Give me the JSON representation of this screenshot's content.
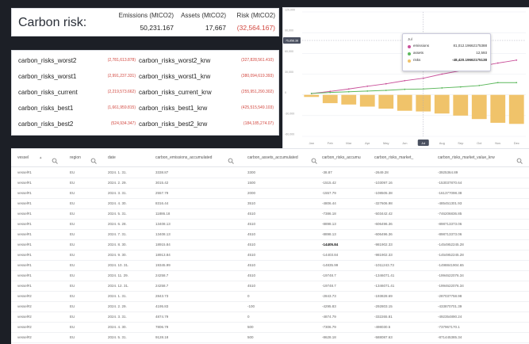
{
  "summary": {
    "title": "Carbon risk:",
    "emissions_header": "Emissions (MtCO2)",
    "emissions_value": "50,231.167",
    "assets_header": "Assets (MtCO2)",
    "assets_value": "17,667",
    "risk_header": "Risk (MtCO2)",
    "risk_value": "(32,564.167)"
  },
  "risk_list": [
    {
      "name": "carbon_risks_worst2",
      "value": "(2,781,613.878)",
      "krw_name": "carbon_risks_worst2_krw",
      "krw_value": "(327,828,561.410)"
    },
    {
      "name": "carbon_risks_worst1",
      "value": "(2,991,237.331)",
      "krw_name": "carbon_risks_worst1_krw",
      "krw_value": "(380,094,619.393)"
    },
    {
      "name": "carbon_risks_current",
      "value": "(2,219,573.662)",
      "krw_name": "carbon_risks_current_krw",
      "krw_value": "(255,951,290.302)"
    },
    {
      "name": "carbon_risks_best1",
      "value": "(1,661,959.815)",
      "krw_name": "carbon_risks_best1_krw",
      "krw_value": "(425,515,549.103)"
    },
    {
      "name": "carbon_risks_best2",
      "value": "(524,934.347)",
      "krw_name": "carbon_risks_best2_krw",
      "krw_value": "(184,185,274.07)"
    }
  ],
  "chart_data": {
    "type": "bar",
    "categories": [
      "Jan",
      "Feb",
      "Mar",
      "Apr",
      "May",
      "Jun",
      "Jul",
      "Aug",
      "Sep",
      "Oct",
      "Nov",
      "Dec"
    ],
    "series": [
      {
        "name": "emissions",
        "type": "line",
        "color": "#c9509a",
        "values": [
          2000,
          5000,
          8500,
          12500,
          16000,
          20500,
          24000,
          30000,
          35000,
          41000,
          46000,
          50231
        ]
      },
      {
        "name": "assets",
        "type": "line",
        "color": "#5cb85c",
        "values": [
          2000,
          3500,
          4500,
          5500,
          6500,
          8000,
          8500,
          10000,
          11500,
          13500,
          17667,
          17667
        ]
      },
      {
        "name": "risks",
        "type": "bar",
        "color": "#f0c36a",
        "values": [
          -3000,
          -12000,
          -14000,
          -17000,
          -20000,
          -23000,
          -24000,
          -27000,
          -30000,
          -35000,
          -40429,
          -42000
        ]
      }
    ],
    "ylim": [
      -60000,
      120000
    ],
    "yticks": [
      "120,000",
      "90,000",
      "60,000",
      "30,000",
      "0",
      "-30,000",
      "-60,000"
    ],
    "crosshair_label": "75,858.38",
    "active_category": "Jul",
    "tooltip": {
      "title": "Jul",
      "rows": [
        {
          "name": "emissions",
          "value": "81,012.19662175388"
        },
        {
          "name": "assets",
          "value": "12,593"
        },
        {
          "name": "risks",
          "value": "-48,420.19662175138"
        }
      ]
    }
  },
  "table": {
    "columns": [
      "vessel",
      "region",
      "date",
      "carbon_emissions_accumulated",
      "carbon_assets_accumulated",
      "carbon_risks_accumu",
      "carbon_risks_market_",
      "carbon_risks_market_value_krw"
    ],
    "rows": [
      [
        "vessel#1",
        "EU",
        "2024. 1. 31.",
        "3338.87",
        "3300",
        "-38.87",
        "-2649.28",
        "-3925364.89"
      ],
      [
        "vessel#1",
        "EU",
        "2024. 2. 29.",
        "3015.42",
        "1500",
        "-1515.42",
        "-103097.16",
        "-153037870.64"
      ],
      [
        "vessel#1",
        "EU",
        "2024. 3. 31.",
        "2557.79",
        "2000",
        "-1557.79",
        "-108505.38",
        "-161377098.38"
      ],
      [
        "vessel#1",
        "EU",
        "2024. 4. 30.",
        "8316.44",
        "3510",
        "-4806.44",
        "-327606.98",
        "-485451301.93"
      ],
      [
        "vessel#1",
        "EU",
        "2024. 5. 31.",
        "11886.18",
        "4510",
        "-7386.18",
        "-503442.42",
        "-746206836.85"
      ],
      [
        "vessel#1",
        "EU",
        "2024. 6. 28.",
        "13408.13",
        "4510",
        "-8898.13",
        "-606496.36",
        "-898713373.06"
      ],
      [
        "vessel#1",
        "EU",
        "2024. 7. 31.",
        "13408.13",
        "4510",
        "-8898.13",
        "-606496.36",
        "-898713373.06"
      ],
      [
        "vessel#1",
        "EU",
        "2024. 8. 30.",
        "18915.84",
        "4510",
        "-14405.84",
        "-981902.33",
        "-1454952245.28"
      ],
      [
        "vessel#1",
        "EU",
        "2024. 9. 30.",
        "18913.84",
        "4510",
        "-14403.84",
        "-981902.33",
        "-1454952245.28"
      ],
      [
        "vessel#1",
        "EU",
        "2024. 10. 31.",
        "19345.99",
        "4510",
        "-14835.99",
        "-1011243.73",
        "-1498841904.65"
      ],
      [
        "vessel#1",
        "EU",
        "2024. 11. 29.",
        "24258.7",
        "4510",
        "-19748.7",
        "-1346071.41",
        "-1994622076.34"
      ],
      [
        "vessel#1",
        "EU",
        "2024. 12. 31.",
        "24258.7",
        "4510",
        "-19748.7",
        "-1346071.41",
        "-1994622076.34"
      ],
      [
        "vessel#2",
        "EU",
        "2024. 1. 31.",
        "2843.73",
        "0",
        "-2843.73",
        "-193828.69",
        "-287037758.98"
      ],
      [
        "vessel#2",
        "EU",
        "2024. 2. 29.",
        "4195.83",
        "-100",
        "-4295.83",
        "-292803.15",
        "-433870701.39"
      ],
      [
        "vessel#2",
        "EU",
        "2024. 3. 31.",
        "4874.79",
        "0",
        "-4874.79",
        "-332265.81",
        "-492354890.24"
      ],
      [
        "vessel#2",
        "EU",
        "2024. 4. 30.",
        "7806.79",
        "500",
        "-7306.79",
        "-498030.5",
        "-737967170.1"
      ],
      [
        "vessel#2",
        "EU",
        "2024. 5. 31.",
        "9128.18",
        "500",
        "-8628.18",
        "-588087.63",
        "-871445385.34"
      ]
    ]
  }
}
